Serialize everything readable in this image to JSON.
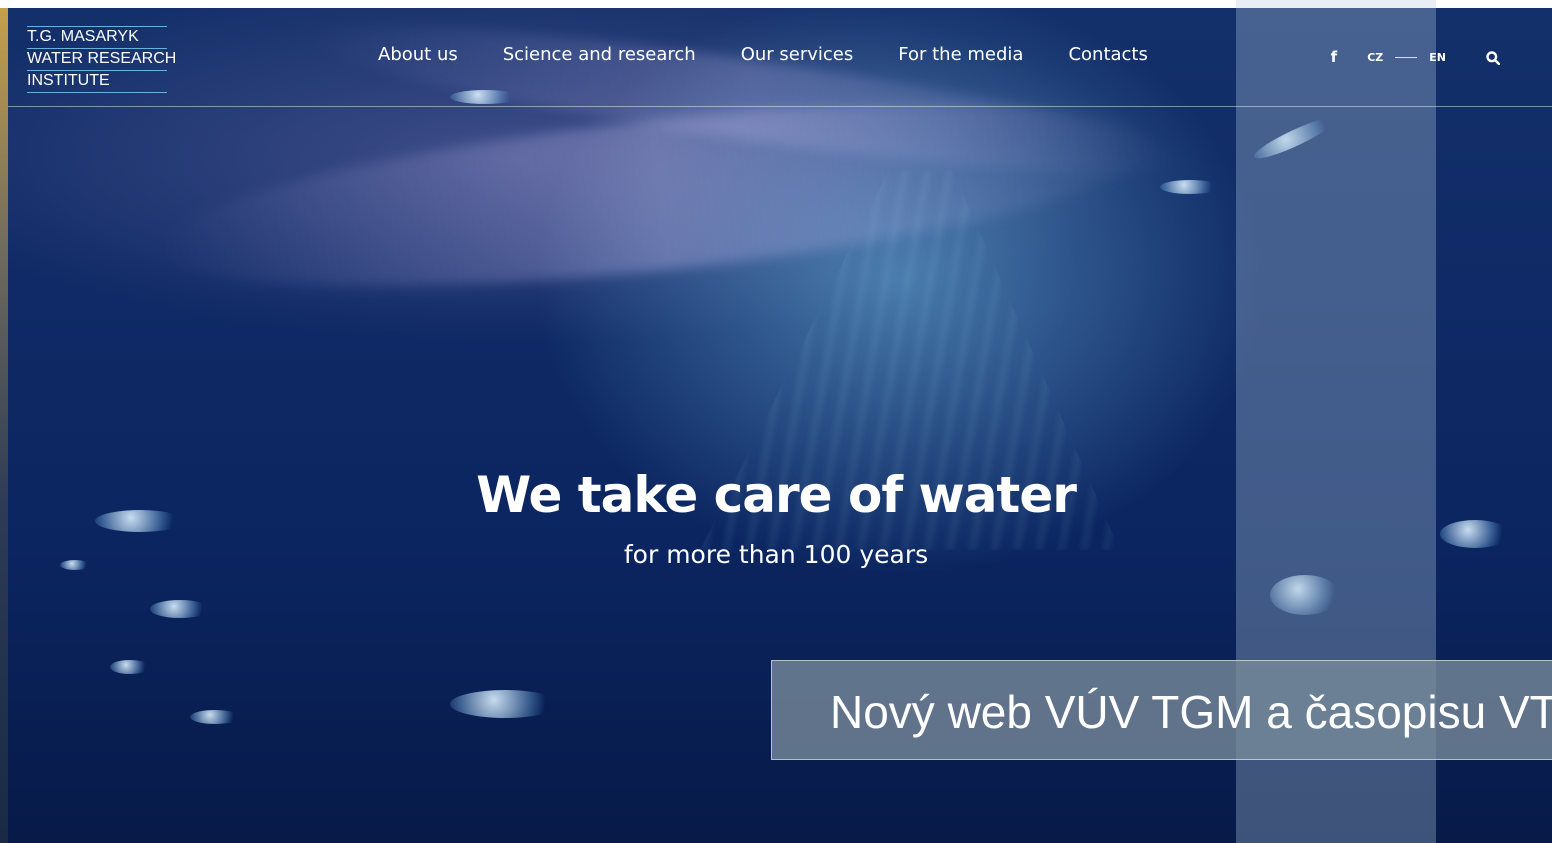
{
  "header": {
    "logo_lines": [
      "T.G. MASARYK",
      "WATER RESEARCH",
      "INSTITUTE"
    ],
    "nav": [
      {
        "label": "About us"
      },
      {
        "label": "Science and research"
      },
      {
        "label": "Our services"
      },
      {
        "label": "For the media"
      },
      {
        "label": "Contacts"
      }
    ],
    "social_icon": "facebook-icon",
    "facebook_glyph": "f",
    "lang_cz": "CZ",
    "lang_en": "EN",
    "search_icon": "search-icon"
  },
  "hero": {
    "title": "We take care of water",
    "subtitle": "for more than 100 years",
    "background": "underwater-sunlight-bubbles"
  },
  "news_banner": {
    "text": "Nový web VÚV TGM a časopisu VTE"
  },
  "colors": {
    "deep_blue": "#0f2a66",
    "logo_underline": "#78c8f0",
    "banner_bg": "#788c9b"
  }
}
